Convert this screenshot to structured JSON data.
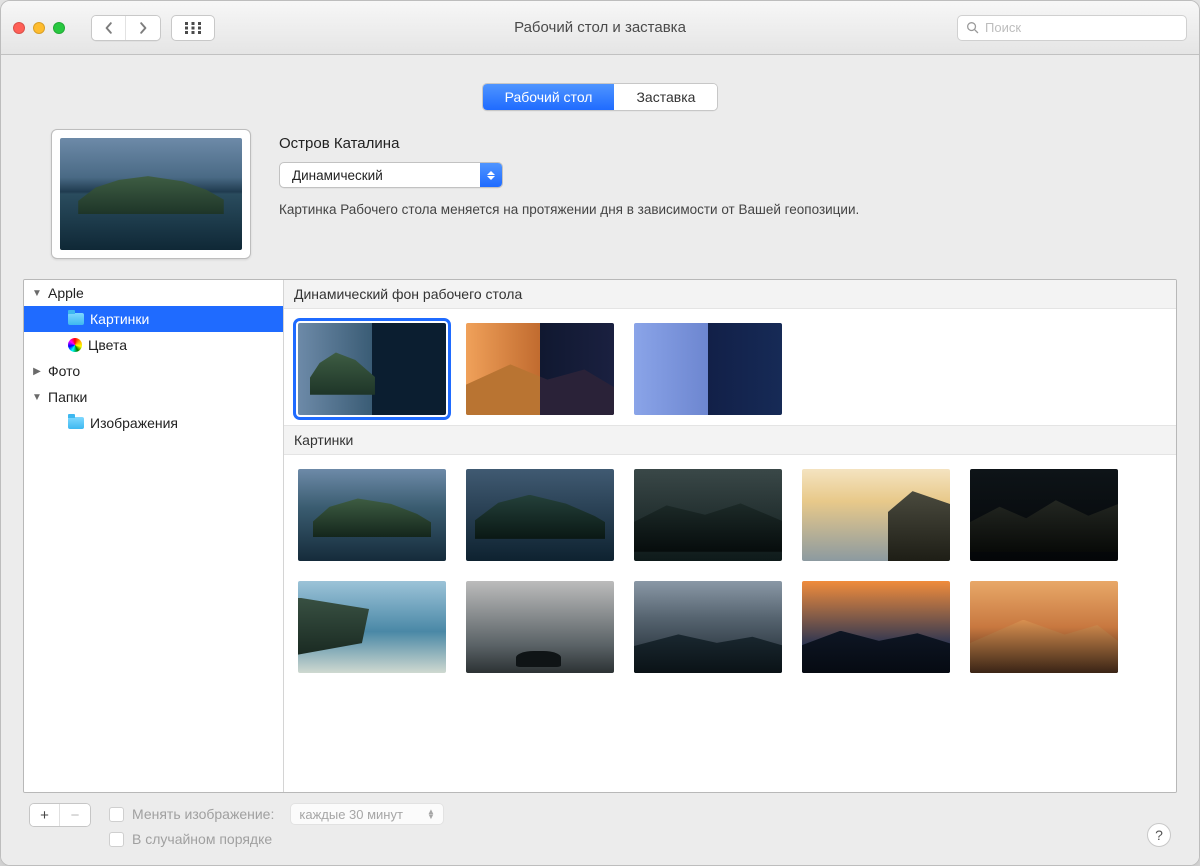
{
  "window": {
    "title": "Рабочий стол и заставка"
  },
  "search": {
    "placeholder": "Поиск"
  },
  "tabs": {
    "desktop": "Рабочий стол",
    "screensaver": "Заставка"
  },
  "preview": {
    "title": "Остров Каталина",
    "mode": "Динамический",
    "description": "Картинка Рабочего стола меняется на протяжении дня в зависимости от Вашей геопозиции."
  },
  "sidebar": {
    "apple": "Apple",
    "pictures": "Картинки",
    "colors": "Цвета",
    "photo": "Фото",
    "folders": "Папки",
    "images_folder": "Изображения"
  },
  "gallery": {
    "dynamic_header": "Динамический фон рабочего стола",
    "pictures_header": "Картинки"
  },
  "footer": {
    "change_label": "Менять изображение:",
    "interval": "каждые 30 минут",
    "random": "В случайном порядке",
    "help": "?"
  }
}
